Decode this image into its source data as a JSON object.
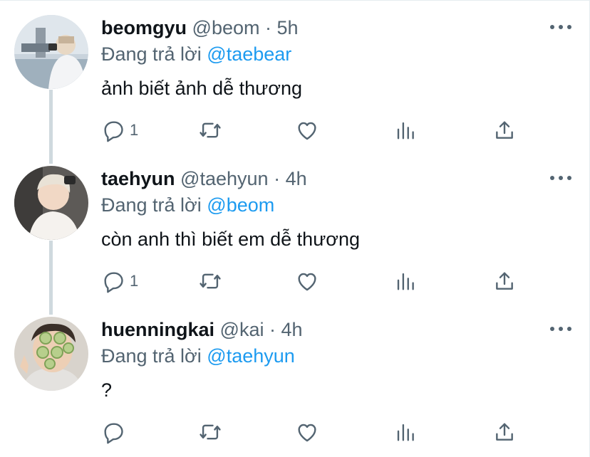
{
  "reply_prefix": "Đang trả lời",
  "dot": "·",
  "colors": {
    "accent": "#1d9bf0",
    "secondary_text": "#536471",
    "primary_text": "#0f1419",
    "thread_line": "#cfd9de"
  },
  "tweets": [
    {
      "name": "beomgyu",
      "handle": "@beom",
      "time": "5h",
      "reply_to": "@taebear",
      "text": "ảnh biết ảnh dễ thương",
      "reply_count": "1",
      "avatar_icon": "avatar-beomgyu"
    },
    {
      "name": "taehyun",
      "handle": "@taehyun",
      "time": "4h",
      "reply_to": "@beom",
      "text": "còn anh thì biết em dễ thương",
      "reply_count": "1",
      "avatar_icon": "avatar-taehyun"
    },
    {
      "name": "huenningkai",
      "handle": "@kai",
      "time": "4h",
      "reply_to": "@taehyun",
      "text": "?",
      "reply_count": "",
      "avatar_icon": "avatar-huenningkai"
    }
  ],
  "icons": [
    "reply-icon",
    "retweet-icon",
    "like-icon",
    "stats-icon",
    "share-icon",
    "more-icon"
  ]
}
